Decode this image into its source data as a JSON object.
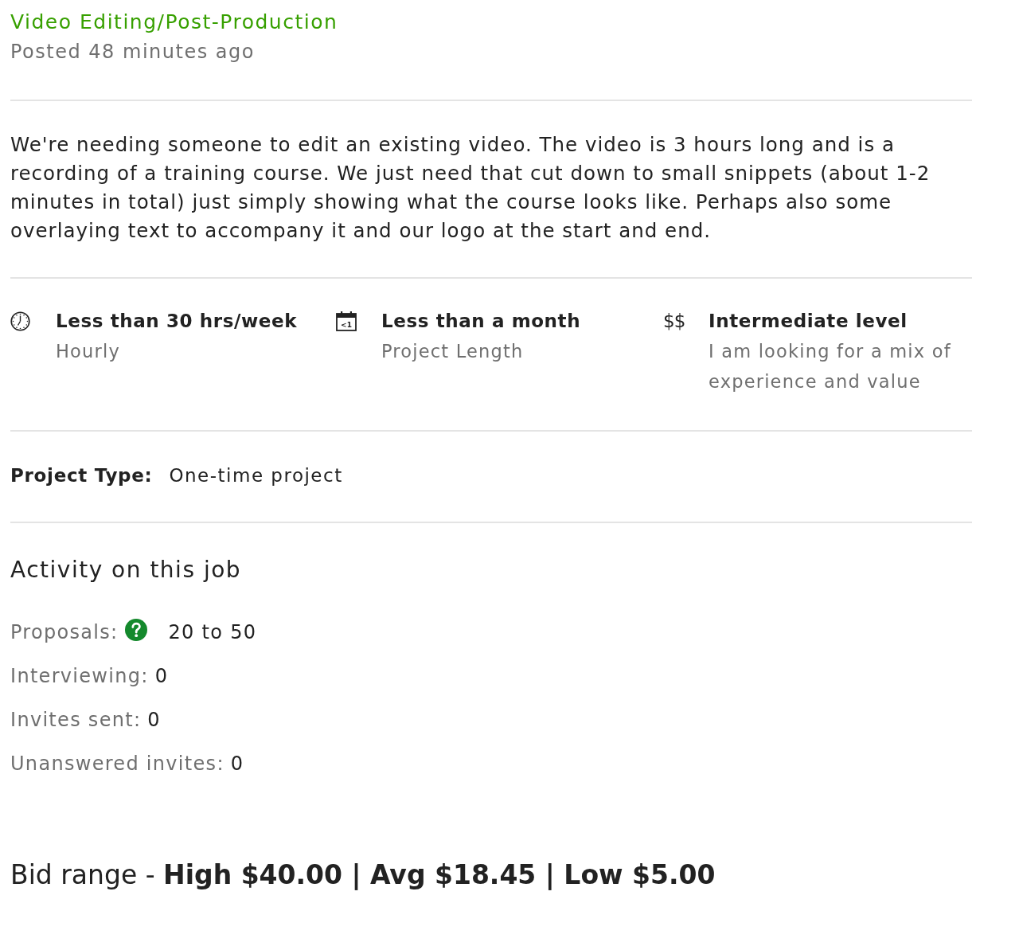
{
  "header": {
    "category": "Video Editing/Post-Production",
    "posted": "Posted 48 minutes ago"
  },
  "description": "We're needing someone to edit an existing video. The video is 3 hours long and is a recording of a training course. We just need that cut down to small snippets (about 1-2 minutes in total) just simply showing what the course looks like. Perhaps also some overlaying text to accompany it and our logo at the start and end.",
  "details": [
    {
      "kind": "clock",
      "title": "Less than 30 hrs/week",
      "subtitle": "Hourly"
    },
    {
      "kind": "calendar",
      "icon_text": "<1",
      "title": "Less than a month",
      "subtitle": "Project Length"
    },
    {
      "kind": "symbol",
      "icon_text": "$$",
      "title": "Intermediate level",
      "subtitle": "I am looking for a mix of experience and value"
    }
  ],
  "project_type": {
    "label": "Project Type:",
    "value": "One-time project"
  },
  "activity": {
    "heading": "Activity on this job",
    "items": [
      {
        "label": "Proposals:",
        "help": true,
        "value": "20 to 50"
      },
      {
        "label": "Interviewing:",
        "help": false,
        "value": "0"
      },
      {
        "label": "Invites sent:",
        "help": false,
        "value": "0"
      },
      {
        "label": "Unanswered invites:",
        "help": false,
        "value": "0"
      }
    ]
  },
  "bid_range": "Bid range - **High $40.00 | Avg $18.45 | Low $5.00**"
}
